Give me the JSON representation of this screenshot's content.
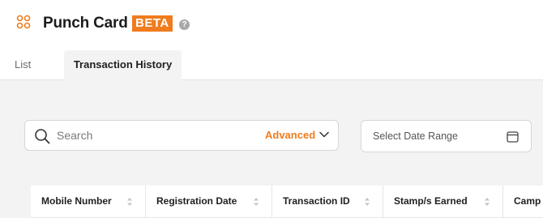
{
  "header": {
    "title": "Punch Card",
    "badge": "BETA",
    "help_icon": "question-circle-icon",
    "app_icon": "four-circles-icon"
  },
  "tabs": [
    {
      "label": "List",
      "active": false
    },
    {
      "label": "Transaction History",
      "active": true
    }
  ],
  "search": {
    "placeholder": "Search",
    "value": "",
    "advanced_label": "Advanced"
  },
  "date_range": {
    "placeholder": "Select Date Range"
  },
  "table": {
    "columns": [
      "Mobile Number",
      "Registration Date",
      "Transaction ID",
      "Stamp/s Earned",
      "Camp"
    ]
  },
  "colors": {
    "accent": "#f07c1e",
    "background": "#f3f3f3",
    "border": "#d6d6d6"
  }
}
